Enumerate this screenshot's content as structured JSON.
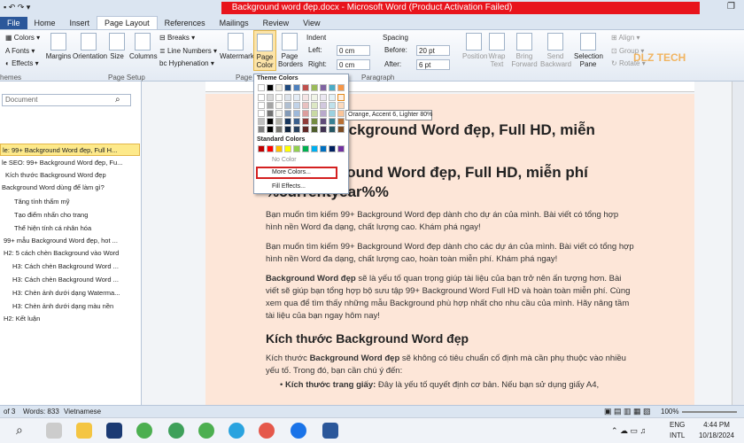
{
  "window": {
    "title": "Background word đẹp.docx - Microsoft Word (Product Activation Failed)"
  },
  "menu": [
    "File",
    "Home",
    "Insert",
    "Page Layout",
    "References",
    "Mailings",
    "Review",
    "View"
  ],
  "ribbon": {
    "themes": "Colors",
    "fonts": "Fonts",
    "effects": "Effects",
    "themes_group": "hemes",
    "margins": "Margins",
    "orientation": "Orientation",
    "size": "Size",
    "columns": "Columns",
    "breaks": "Breaks",
    "line_numbers": "Line Numbers",
    "hyphenation": "Hyphenation",
    "page_setup": "Page Setup",
    "watermark": "Watermark",
    "page_color": "Page Color",
    "page_borders": "Page Borders",
    "page_bg": "Page B",
    "indent": "Indent",
    "left_label": "Left:",
    "left_val": "0 cm",
    "right_label": "Right:",
    "right_val": "0 cm",
    "spacing": "Spacing",
    "before_label": "Before:",
    "before_val": "20 pt",
    "after_label": "After:",
    "after_val": "6 pt",
    "paragraph": "Paragraph",
    "position": "Position",
    "wrap_text": "Wrap Text",
    "bring_forward": "Bring Forward",
    "send_backward": "Send Backward",
    "selection_pane": "Selection Pane",
    "align": "Align",
    "group": "Group",
    "rotate": "Rotate",
    "watermark_logo": "DLZ TECH"
  },
  "nav": {
    "search_placeholder": "Document",
    "items": [
      "le: 99+ Background Word đẹp, Full H...",
      "le SEO: 99+ Background Word đẹp, Fu...",
      "Kích thước Background Word đẹp",
      "Background Word dùng để làm gì?",
      "Tăng tính thẩm mỹ",
      "Tạo điểm nhấn cho trang",
      "Thể hiện tính cá nhân hóa",
      "99+ mẫu Background Word đẹp, hot ...",
      "H2: 5 cách chèn Background vào Word",
      "H3: Cách chèn Background Word ...",
      "H3: Cách chèn Background Word ...",
      "H3: Chèn ảnh dưới dạng Waterma...",
      "H3: Chèn ảnh dưới dạng màu nền",
      "H2: Kết luận"
    ]
  },
  "popup": {
    "theme_colors": "Theme Colors",
    "standard_colors": "Standard Colors",
    "no_color": "No Color",
    "more_colors": "More Colors...",
    "fill_effects": "Fill Effects...",
    "tooltip": "Orange, Accent 6, Lighter 80%"
  },
  "doc": {
    "h1a": "...ackground Word đẹp, Full HD, miễn",
    "h1b": "99+ Background Word đẹp, Full HD, miễn phí %currentyear%%",
    "p1": "Bạn muốn tìm kiếm 99+ Background Word đẹp dành cho dự án của mình. Bài viết có tổng hợp hình nền Word đa dạng, chất lượng cao. Khám phá ngay!",
    "p2": "Bạn muốn tìm kiếm 99+ Background Word đẹp dành cho các dự án của mình. Bài viết có tổng hợp hình nền Word đa dạng, chất lượng cao, hoàn toàn miễn phí. Khám phá ngay!",
    "p3_bold": "Background Word đẹp",
    "p3": " sẽ là yếu tố quan trọng giúp tài liệu của bạn trở nên ấn tượng hơn. Bài viết sẽ giúp bạn tổng hợp bộ sưu tập 99+ Background Word Full HD và hoàn toàn miễn phí. Cùng xem qua để tìm thấy những mẫu Background phù hợp nhất cho nhu cầu của mình. Hãy nâng tầm tài liệu của bạn ngay hôm nay!",
    "h2": "Kích thước Background Word đẹp",
    "p4a": "Kích thước ",
    "p4_bold": "Background Word đẹp",
    "p4b": " sẽ không có tiêu chuẩn cố định mà cần phụ thuộc vào nhiều yếu tố. Trong đó, bạn cần chú ý đến:",
    "bullet_bold": "Kích thước trang giấy:",
    "bullet": " Đây là yếu tố quyết định cơ bản. Nếu bạn sử dụng giấy A4,"
  },
  "status": {
    "page": "of 3",
    "words": "Words: 833",
    "lang": "Vietnamese",
    "zoom": "100%"
  },
  "taskbar": {
    "lang1": "ENG",
    "lang2": "INTL",
    "time": "4:44 PM",
    "date": "10/18/2024"
  },
  "colors": {
    "title_red": "#e8141c",
    "page_bg": "#fde6d8",
    "highlight": "#fde98a",
    "more_border": "#d42020"
  }
}
